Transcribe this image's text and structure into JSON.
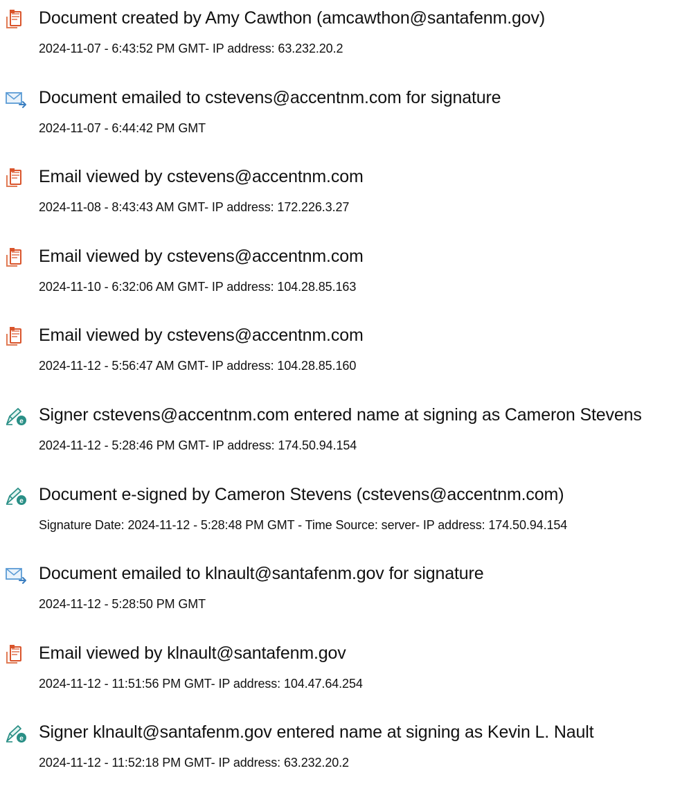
{
  "events": [
    {
      "icon": "document-icon",
      "title": "Document created by Amy Cawthon (amcawthon@santafenm.gov)",
      "detail": "2024-11-07 - 6:43:52 PM GMT- IP address: 63.232.20.2"
    },
    {
      "icon": "email-send-icon",
      "title": "Document emailed to cstevens@accentnm.com for signature",
      "detail": "2024-11-07 - 6:44:42 PM GMT"
    },
    {
      "icon": "document-icon",
      "title": "Email viewed by cstevens@accentnm.com",
      "detail": "2024-11-08 - 8:43:43 AM GMT- IP address: 172.226.3.27"
    },
    {
      "icon": "document-icon",
      "title": "Email viewed by cstevens@accentnm.com",
      "detail": "2024-11-10 - 6:32:06 AM GMT- IP address: 104.28.85.163"
    },
    {
      "icon": "document-icon",
      "title": "Email viewed by cstevens@accentnm.com",
      "detail": "2024-11-12 - 5:56:47 AM GMT- IP address: 104.28.85.160"
    },
    {
      "icon": "signature-pen-icon",
      "title": "Signer cstevens@accentnm.com entered name at signing as Cameron Stevens",
      "detail": "2024-11-12 - 5:28:46 PM GMT- IP address: 174.50.94.154"
    },
    {
      "icon": "signature-pen-icon",
      "title": "Document e-signed by Cameron Stevens (cstevens@accentnm.com)",
      "detail": "Signature Date: 2024-11-12 - 5:28:48 PM GMT - Time Source: server- IP address: 174.50.94.154"
    },
    {
      "icon": "email-send-icon",
      "title": "Document emailed to klnault@santafenm.gov for signature",
      "detail": "2024-11-12 - 5:28:50 PM GMT"
    },
    {
      "icon": "document-icon",
      "title": "Email viewed by klnault@santafenm.gov",
      "detail": "2024-11-12 - 11:51:56 PM GMT- IP address: 104.47.64.254"
    },
    {
      "icon": "signature-pen-icon",
      "title": "Signer klnault@santafenm.gov entered name at signing as Kevin L. Nault",
      "detail": "2024-11-12 - 11:52:18 PM GMT- IP address: 63.232.20.2"
    }
  ],
  "colors": {
    "document_icon": "#d9542b",
    "email_icon": "#5b9bd5",
    "signature_icon": "#2a8f86",
    "text": "#111111"
  }
}
